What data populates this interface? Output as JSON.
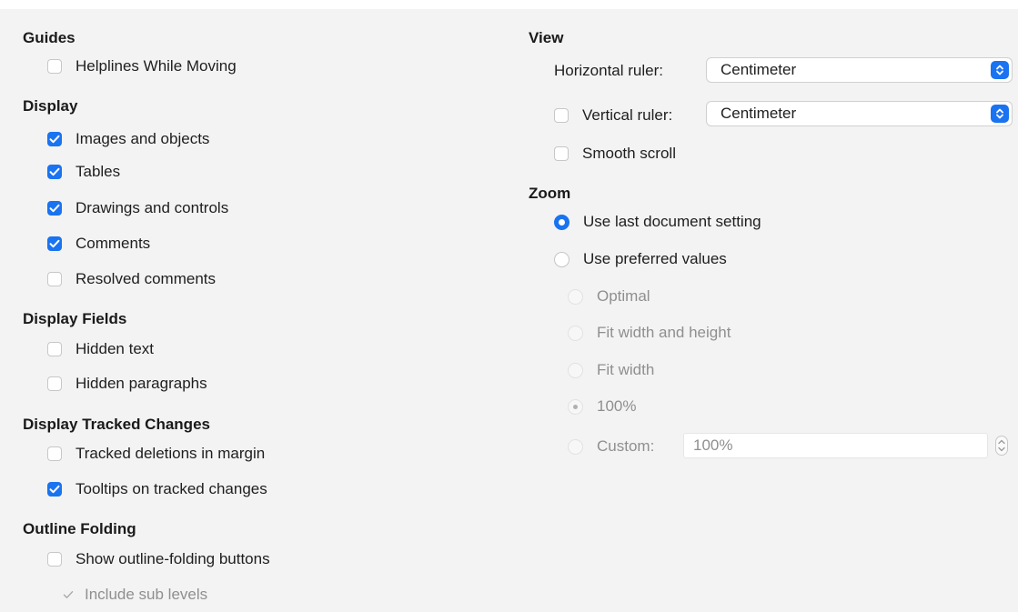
{
  "guides": {
    "heading": "Guides",
    "helplines_while_moving": {
      "label": "Helplines While Moving",
      "checked": false
    }
  },
  "display": {
    "heading": "Display",
    "images_and_objects": {
      "label": "Images and objects",
      "checked": true
    },
    "tables": {
      "label": "Tables",
      "checked": true
    },
    "drawings_and_controls": {
      "label": "Drawings and controls",
      "checked": true
    },
    "comments": {
      "label": "Comments",
      "checked": true
    },
    "resolved_comments": {
      "label": "Resolved comments",
      "checked": false
    }
  },
  "display_fields": {
    "heading": "Display Fields",
    "hidden_text": {
      "label": "Hidden text",
      "checked": false
    },
    "hidden_paragraphs": {
      "label": "Hidden paragraphs",
      "checked": false
    }
  },
  "display_tracked_changes": {
    "heading": "Display Tracked Changes",
    "tracked_deletions_in_margin": {
      "label": "Tracked deletions in margin",
      "checked": false
    },
    "tooltips_on_tracked_changes": {
      "label": "Tooltips on tracked changes",
      "checked": true
    }
  },
  "outline_folding": {
    "heading": "Outline Folding",
    "show_outline_folding_buttons": {
      "label": "Show outline-folding buttons",
      "checked": false
    },
    "include_sub_levels": {
      "label": "Include sub levels",
      "checked": true,
      "enabled": false
    }
  },
  "view": {
    "heading": "View",
    "horizontal_ruler": {
      "label": "Horizontal ruler:",
      "value": "Centimeter"
    },
    "vertical_ruler": {
      "label": "Vertical ruler:",
      "checked": false,
      "value": "Centimeter"
    },
    "smooth_scroll": {
      "label": "Smooth scroll",
      "checked": false
    }
  },
  "zoom": {
    "heading": "Zoom",
    "use_last_document_setting": {
      "label": "Use last document setting",
      "selected": true
    },
    "use_preferred_values": {
      "label": "Use preferred values",
      "selected": false
    },
    "optimal": {
      "label": "Optimal",
      "enabled": false
    },
    "fit_width_and_height": {
      "label": "Fit width and height",
      "enabled": false
    },
    "fit_width": {
      "label": "Fit width",
      "enabled": false
    },
    "percent_100": {
      "label": "100%",
      "enabled": false,
      "selected": true
    },
    "custom": {
      "label": "Custom:",
      "enabled": false,
      "value": "100%"
    }
  },
  "colors": {
    "accent": "#1a73f0",
    "panel": "#f3f3f3",
    "disabled_text": "#8f8f8f"
  }
}
